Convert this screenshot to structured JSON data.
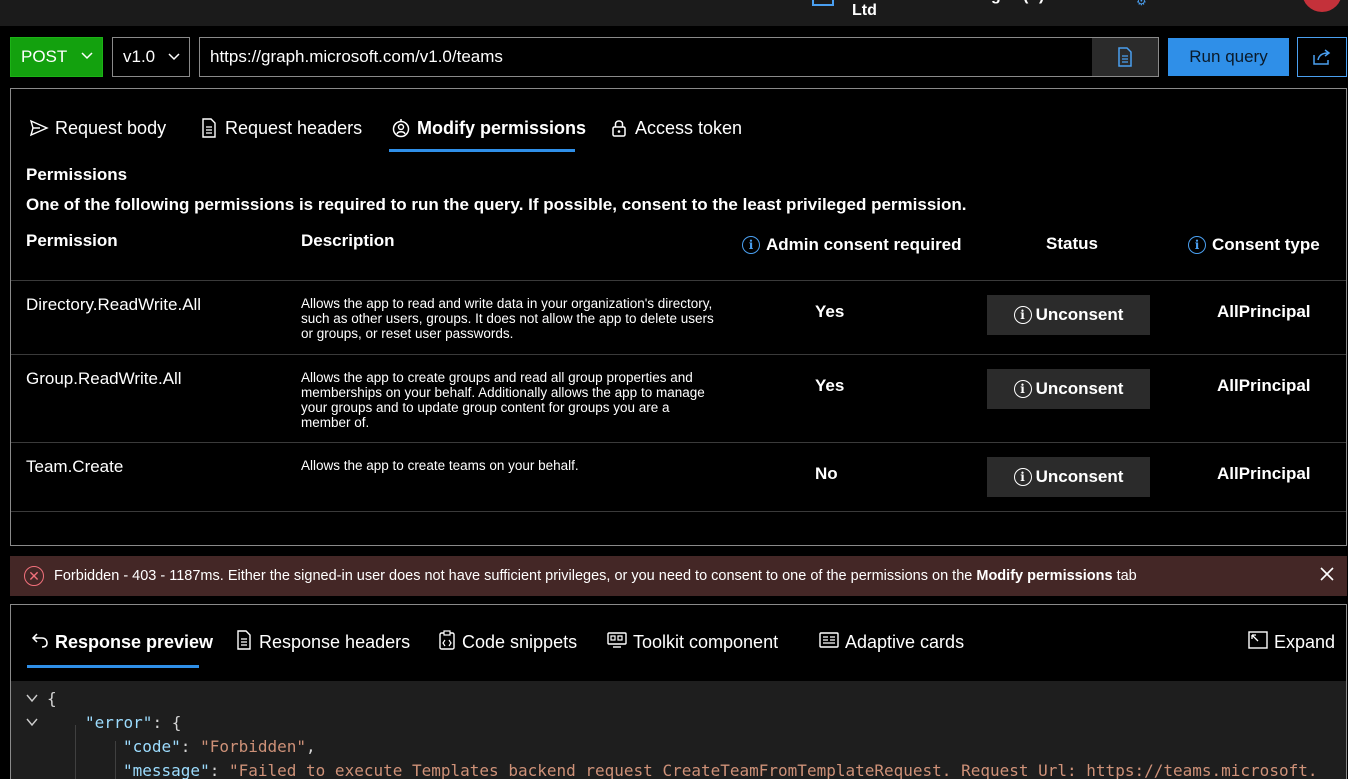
{
  "top": {
    "tenant": "Wenzins Technologies(P) Pvt Ltd"
  },
  "query": {
    "method": "POST",
    "version": "v1.0",
    "url": "https://graph.microsoft.com/v1.0/teams",
    "run_label": "Run query"
  },
  "request_tabs": [
    {
      "label": "Request body",
      "icon": "send-icon"
    },
    {
      "label": "Request headers",
      "icon": "document-icon"
    },
    {
      "label": "Modify permissions",
      "icon": "shield-person-icon"
    },
    {
      "label": "Access token",
      "icon": "lock-icon"
    }
  ],
  "permissions": {
    "title": "Permissions",
    "description": "One of the following permissions is required to run the query. If possible, consent to the least privileged permission.",
    "columns": {
      "permission": "Permission",
      "description": "Description",
      "admin": "Admin consent required",
      "status": "Status",
      "consent_type": "Consent type"
    },
    "rows": [
      {
        "name": "Directory.ReadWrite.All",
        "description": "Allows the app to read and write data in your organization's directory, such as other users, groups. It does not allow the app to delete users or groups, or reset user passwords.",
        "admin": "Yes",
        "status": "Unconsent",
        "consent_type": "AllPrincipal"
      },
      {
        "name": "Group.ReadWrite.All",
        "description": "Allows the app to create groups and read all group properties and memberships on your behalf. Additionally allows the app to manage your groups and to update group content for groups you are a member of.",
        "admin": "Yes",
        "status": "Unconsent",
        "consent_type": "AllPrincipal"
      },
      {
        "name": "Team.Create",
        "description": "Allows the app to create teams on your behalf.",
        "admin": "No",
        "status": "Unconsent",
        "consent_type": "AllPrincipal"
      }
    ]
  },
  "error": {
    "message": "Forbidden - 403 - 1187ms. Either the signed-in user does not have sufficient privileges, or you need to consent to one of the permissions on the ",
    "bold": "Modify permissions",
    "suffix": " tab"
  },
  "response_tabs": [
    {
      "label": "Response preview",
      "icon": "undo-icon"
    },
    {
      "label": "Response headers",
      "icon": "document-icon"
    },
    {
      "label": "Code snippets",
      "icon": "clipboard-code-icon"
    },
    {
      "label": "Toolkit component",
      "icon": "toolkit-icon"
    },
    {
      "label": "Adaptive cards",
      "icon": "card-icon"
    }
  ],
  "expand_label": "Expand",
  "code": {
    "l1": "{",
    "l2_key": "\"error\"",
    "l2_rest": ": {",
    "l3_key": "\"code\"",
    "l3_sep": ": ",
    "l3_val": "\"Forbidden\"",
    "l3_end": ",",
    "l4_key": "\"message\"",
    "l4_sep": ": ",
    "l4_val": "\"Failed to execute Templates backend request CreateTeamFromTemplateRequest. Request Url: https://teams.microsoft."
  },
  "colors": {
    "method": "#13a10e",
    "accent": "#2f8fe8",
    "error_bg": "#442726"
  }
}
